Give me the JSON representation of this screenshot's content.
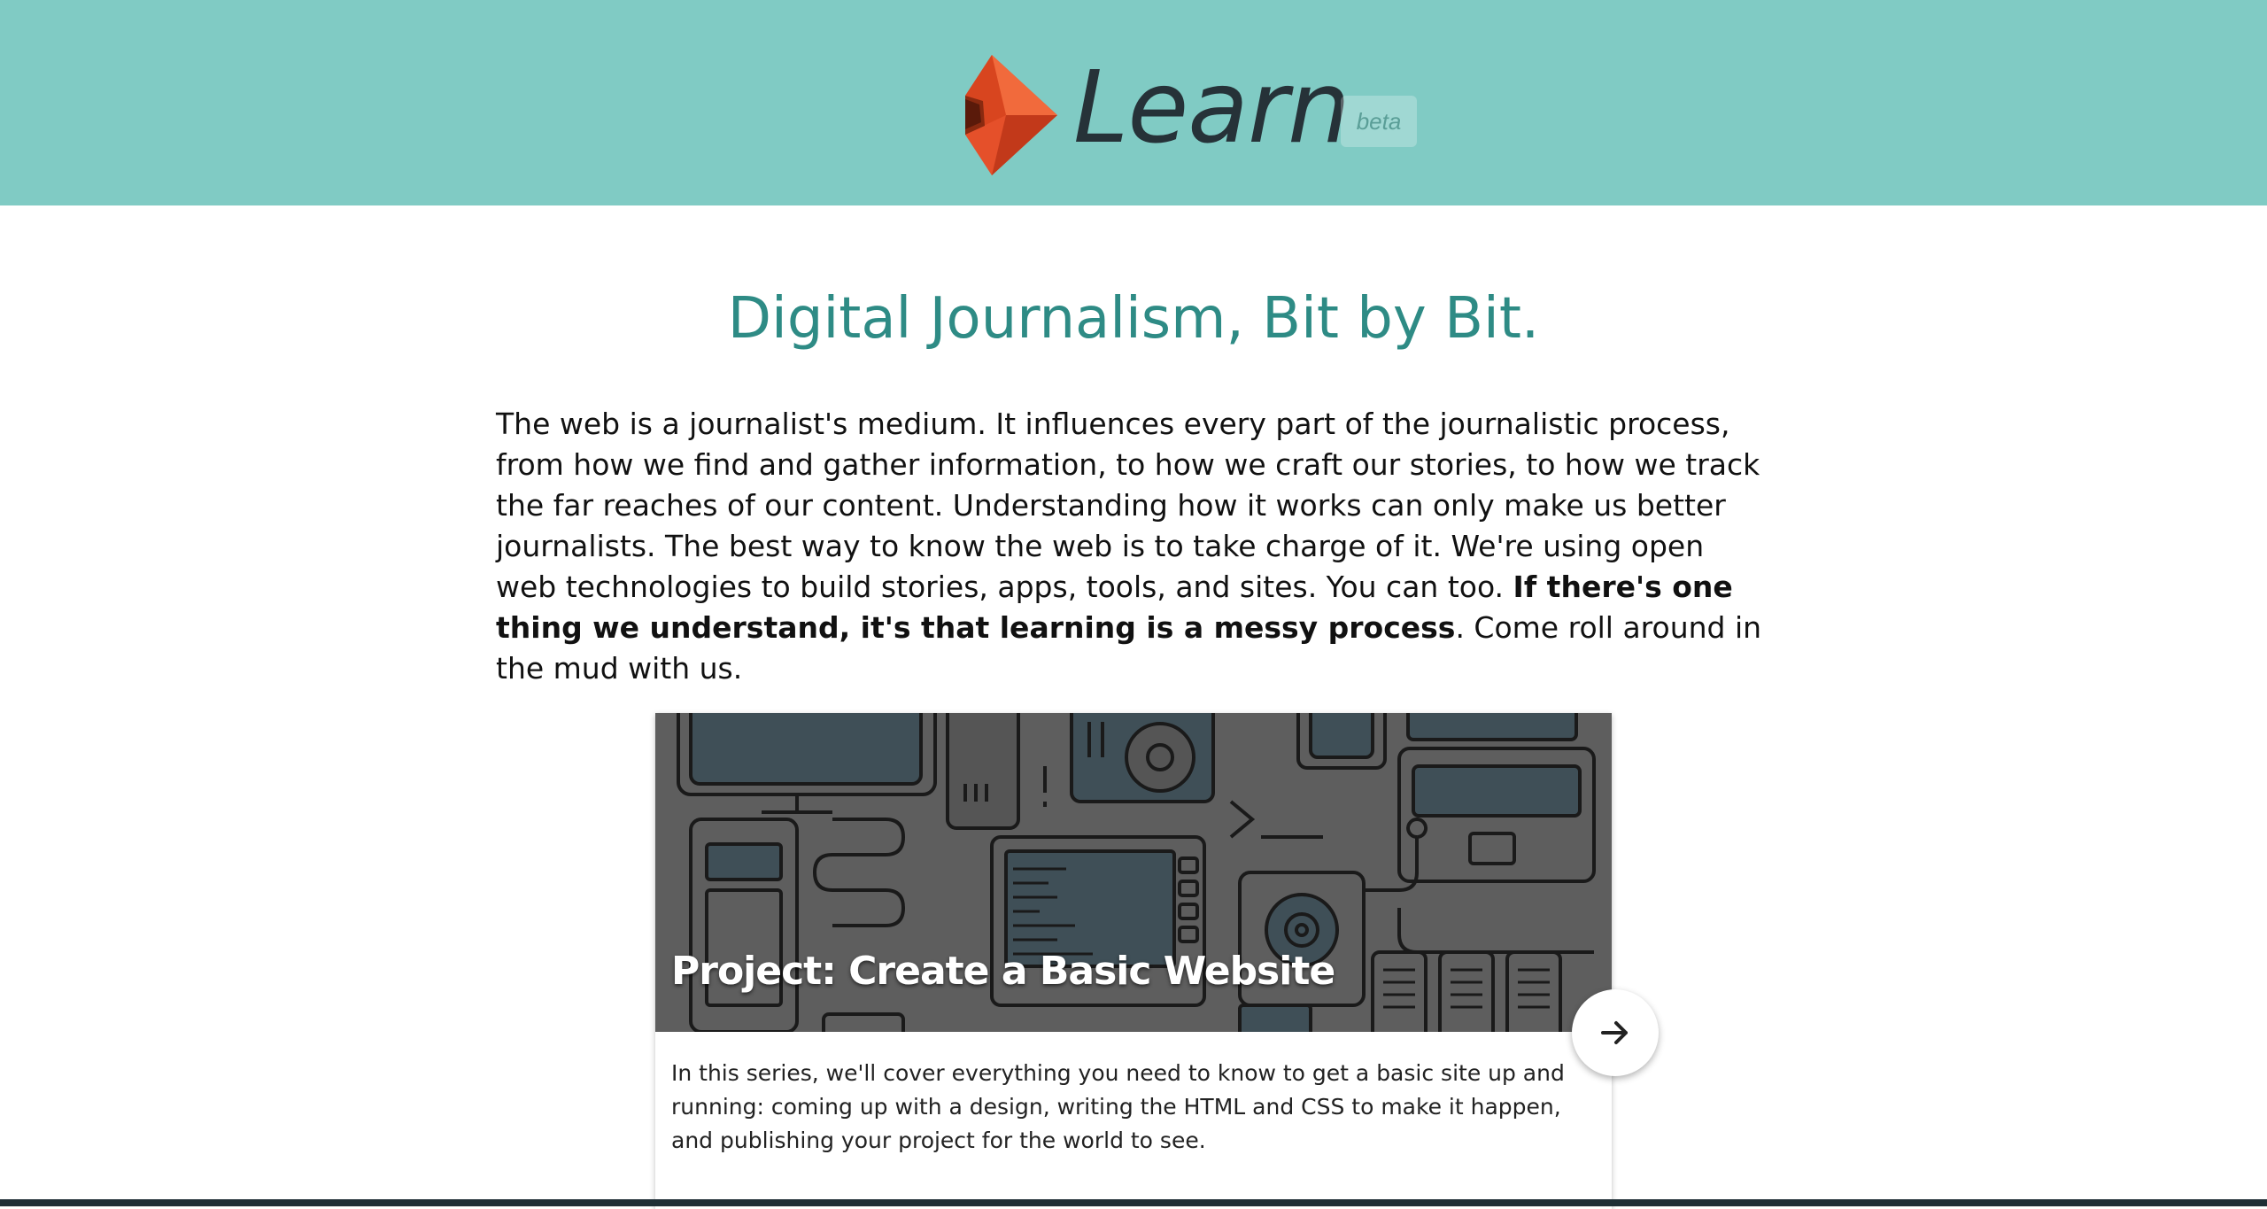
{
  "header": {
    "logo_text": "Learn",
    "beta_label": "beta",
    "background": "#80cbc4",
    "logo_icon": "diamond-logo-icon"
  },
  "main": {
    "tagline": "Digital Journalism, Bit by Bit.",
    "intro_text_1": "The web is a journalist's medium. It influences every part of the journalistic process, from how we find and gather information, to how we craft our stories, to how we track the far reaches of our content. Understanding how it works can only make us better journalists. The best way to know the web is to take charge of it. We're using open web technologies to build stories, apps, tools, and sites. You can too. ",
    "intro_bold": "If there's one thing we understand, it's that learning is a messy process",
    "intro_text_2": ". Come roll around in the mud with us.",
    "tagline_color": "#2e8b85"
  },
  "card": {
    "title": "Project: Create a Basic Website",
    "description": "In this series, we'll cover everything you need to know to get a basic site up and running: coming up with a design, writing the HTML and CSS to make it happen, and publishing your project for the world to see.",
    "image_icon": "tech-illustration",
    "next_icon": "arrow-right-icon"
  }
}
